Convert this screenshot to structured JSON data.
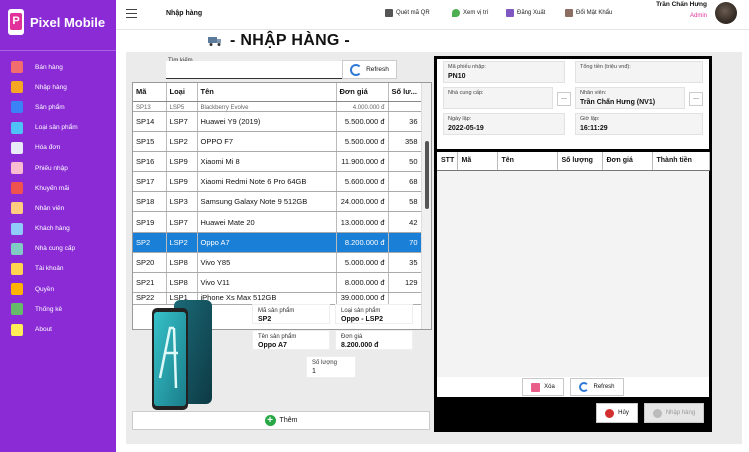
{
  "app": {
    "name": "Pixel Mobile"
  },
  "sidebar": {
    "items": [
      {
        "label": "Bán hàng",
        "icon": "cash-register-icon",
        "color": "#f26d6d"
      },
      {
        "label": "Nhập hàng",
        "icon": "import-truck-icon",
        "color": "#f5a623"
      },
      {
        "label": "Sản phẩm",
        "icon": "smartphone-icon",
        "color": "#3b82f6"
      },
      {
        "label": "Loại sản phẩm",
        "icon": "category-icon",
        "color": "#4fc3f7"
      },
      {
        "label": "Hóa đơn",
        "icon": "invoice-icon",
        "color": "#e8eaf6"
      },
      {
        "label": "Phiếu nhập",
        "icon": "receipt-icon",
        "color": "#f8bbd0"
      },
      {
        "label": "Khuyến mãi",
        "icon": "gift-icon",
        "color": "#ef5350"
      },
      {
        "label": "Nhân viên",
        "icon": "employees-icon",
        "color": "#ffcc80"
      },
      {
        "label": "Khách hàng",
        "icon": "customer-icon",
        "color": "#90caf9"
      },
      {
        "label": "Nhà cung cấp",
        "icon": "supplier-building-icon",
        "color": "#80cbc4"
      },
      {
        "label": "Tài khoản",
        "icon": "key-icon",
        "color": "#ffd54f"
      },
      {
        "label": "Quyền",
        "icon": "permission-badge-icon",
        "color": "#ffb300"
      },
      {
        "label": "Thống kê",
        "icon": "chart-icon",
        "color": "#66bb6a"
      },
      {
        "label": "About",
        "icon": "info-note-icon",
        "color": "#ffee58"
      }
    ]
  },
  "topbar": {
    "breadcrumb": "Nhập hàng",
    "buttons": [
      {
        "label": "Quét mã QR",
        "icon": "qr-scan-icon",
        "color": "#555555"
      },
      {
        "label": "Xem vị trí",
        "icon": "map-pin-icon",
        "color": "#4caf50"
      },
      {
        "label": "Đăng Xuất",
        "icon": "logout-icon",
        "color": "#7e57c2"
      },
      {
        "label": "Đổi Mật Khẩu",
        "icon": "change-password-icon",
        "color": "#8d6e63"
      }
    ],
    "user": {
      "name": "Trần Chấn Hưng",
      "role": "Admin"
    }
  },
  "page": {
    "title": "- NHẬP HÀNG -"
  },
  "search": {
    "label": "Tìm kiếm",
    "value": "",
    "refresh_label": "Refresh"
  },
  "product_table": {
    "columns": [
      "Mã",
      "Loại",
      "Tên",
      "Đơn giá",
      "Số lư..."
    ],
    "partial_top": {
      "id": "SP13",
      "type": "LSP5",
      "name": "Blackberry Evolve",
      "price": "4.000.000 đ",
      "qty": ""
    },
    "rows": [
      {
        "id": "SP14",
        "type": "LSP7",
        "name": "Huawei Y9 (2019)",
        "price": "5.500.000 đ",
        "qty": "36"
      },
      {
        "id": "SP15",
        "type": "LSP2",
        "name": "OPPO F7",
        "price": "5.500.000 đ",
        "qty": "358"
      },
      {
        "id": "SP16",
        "type": "LSP9",
        "name": "Xiaomi Mi 8",
        "price": "11.900.000 đ",
        "qty": "50"
      },
      {
        "id": "SP17",
        "type": "LSP9",
        "name": "Xiaomi Redmi Note 6 Pro 64GB",
        "price": "5.600.000 đ",
        "qty": "68"
      },
      {
        "id": "SP18",
        "type": "LSP3",
        "name": "Samsung Galaxy Note 9 512GB",
        "price": "24.000.000 đ",
        "qty": "58"
      },
      {
        "id": "SP19",
        "type": "LSP7",
        "name": "Huawei Mate 20",
        "price": "13.000.000 đ",
        "qty": "42"
      },
      {
        "id": "SP2",
        "type": "LSP2",
        "name": "Oppo A7",
        "price": "8.200.000 đ",
        "qty": "70",
        "selected": true
      },
      {
        "id": "SP20",
        "type": "LSP8",
        "name": "Vivo Y85",
        "price": "5.000.000 đ",
        "qty": "35"
      },
      {
        "id": "SP21",
        "type": "LSP8",
        "name": "Vivo V11",
        "price": "8.000.000 đ",
        "qty": "129"
      }
    ],
    "partial_bottom": {
      "id": "SP22",
      "type": "LSP1",
      "name": "iPhone Xs Max 512GB",
      "price": "39.000.000 đ",
      "qty": ""
    }
  },
  "product_detail": {
    "code_label": "Mã sản phẩm",
    "code": "SP2",
    "type_label": "Loại sản phẩm",
    "type": "Oppo - LSP2",
    "name_label": "Tên sản phẩm",
    "name": "Oppo A7",
    "price_label": "Đơn giá",
    "price": "8.200.000 đ",
    "qty_label": "Số lượng",
    "qty": "1",
    "add_label": "Thêm"
  },
  "receipt": {
    "code_label": "Mã phiếu nhập:",
    "code": "PN10",
    "total_label": "Tổng tiền (triệu vnđ):",
    "total": "",
    "supplier_label": "Nhà cung cấp:",
    "supplier": "",
    "employee_label": "Nhân viên:",
    "employee": "Trần Chấn Hưng (NV1)",
    "date_label": "Ngày lập:",
    "date": "2022-05-19",
    "time_label": "Giờ lập:",
    "time": "16:11:29",
    "dots": "...",
    "columns": [
      "STT",
      "Mã",
      "Tên",
      "Số lượng",
      "Đơn giá",
      "Thành tiền"
    ],
    "delete_label": "Xóa",
    "refresh_label": "Refresh",
    "cancel_label": "Hủy",
    "import_label": "Nhập hàng"
  }
}
